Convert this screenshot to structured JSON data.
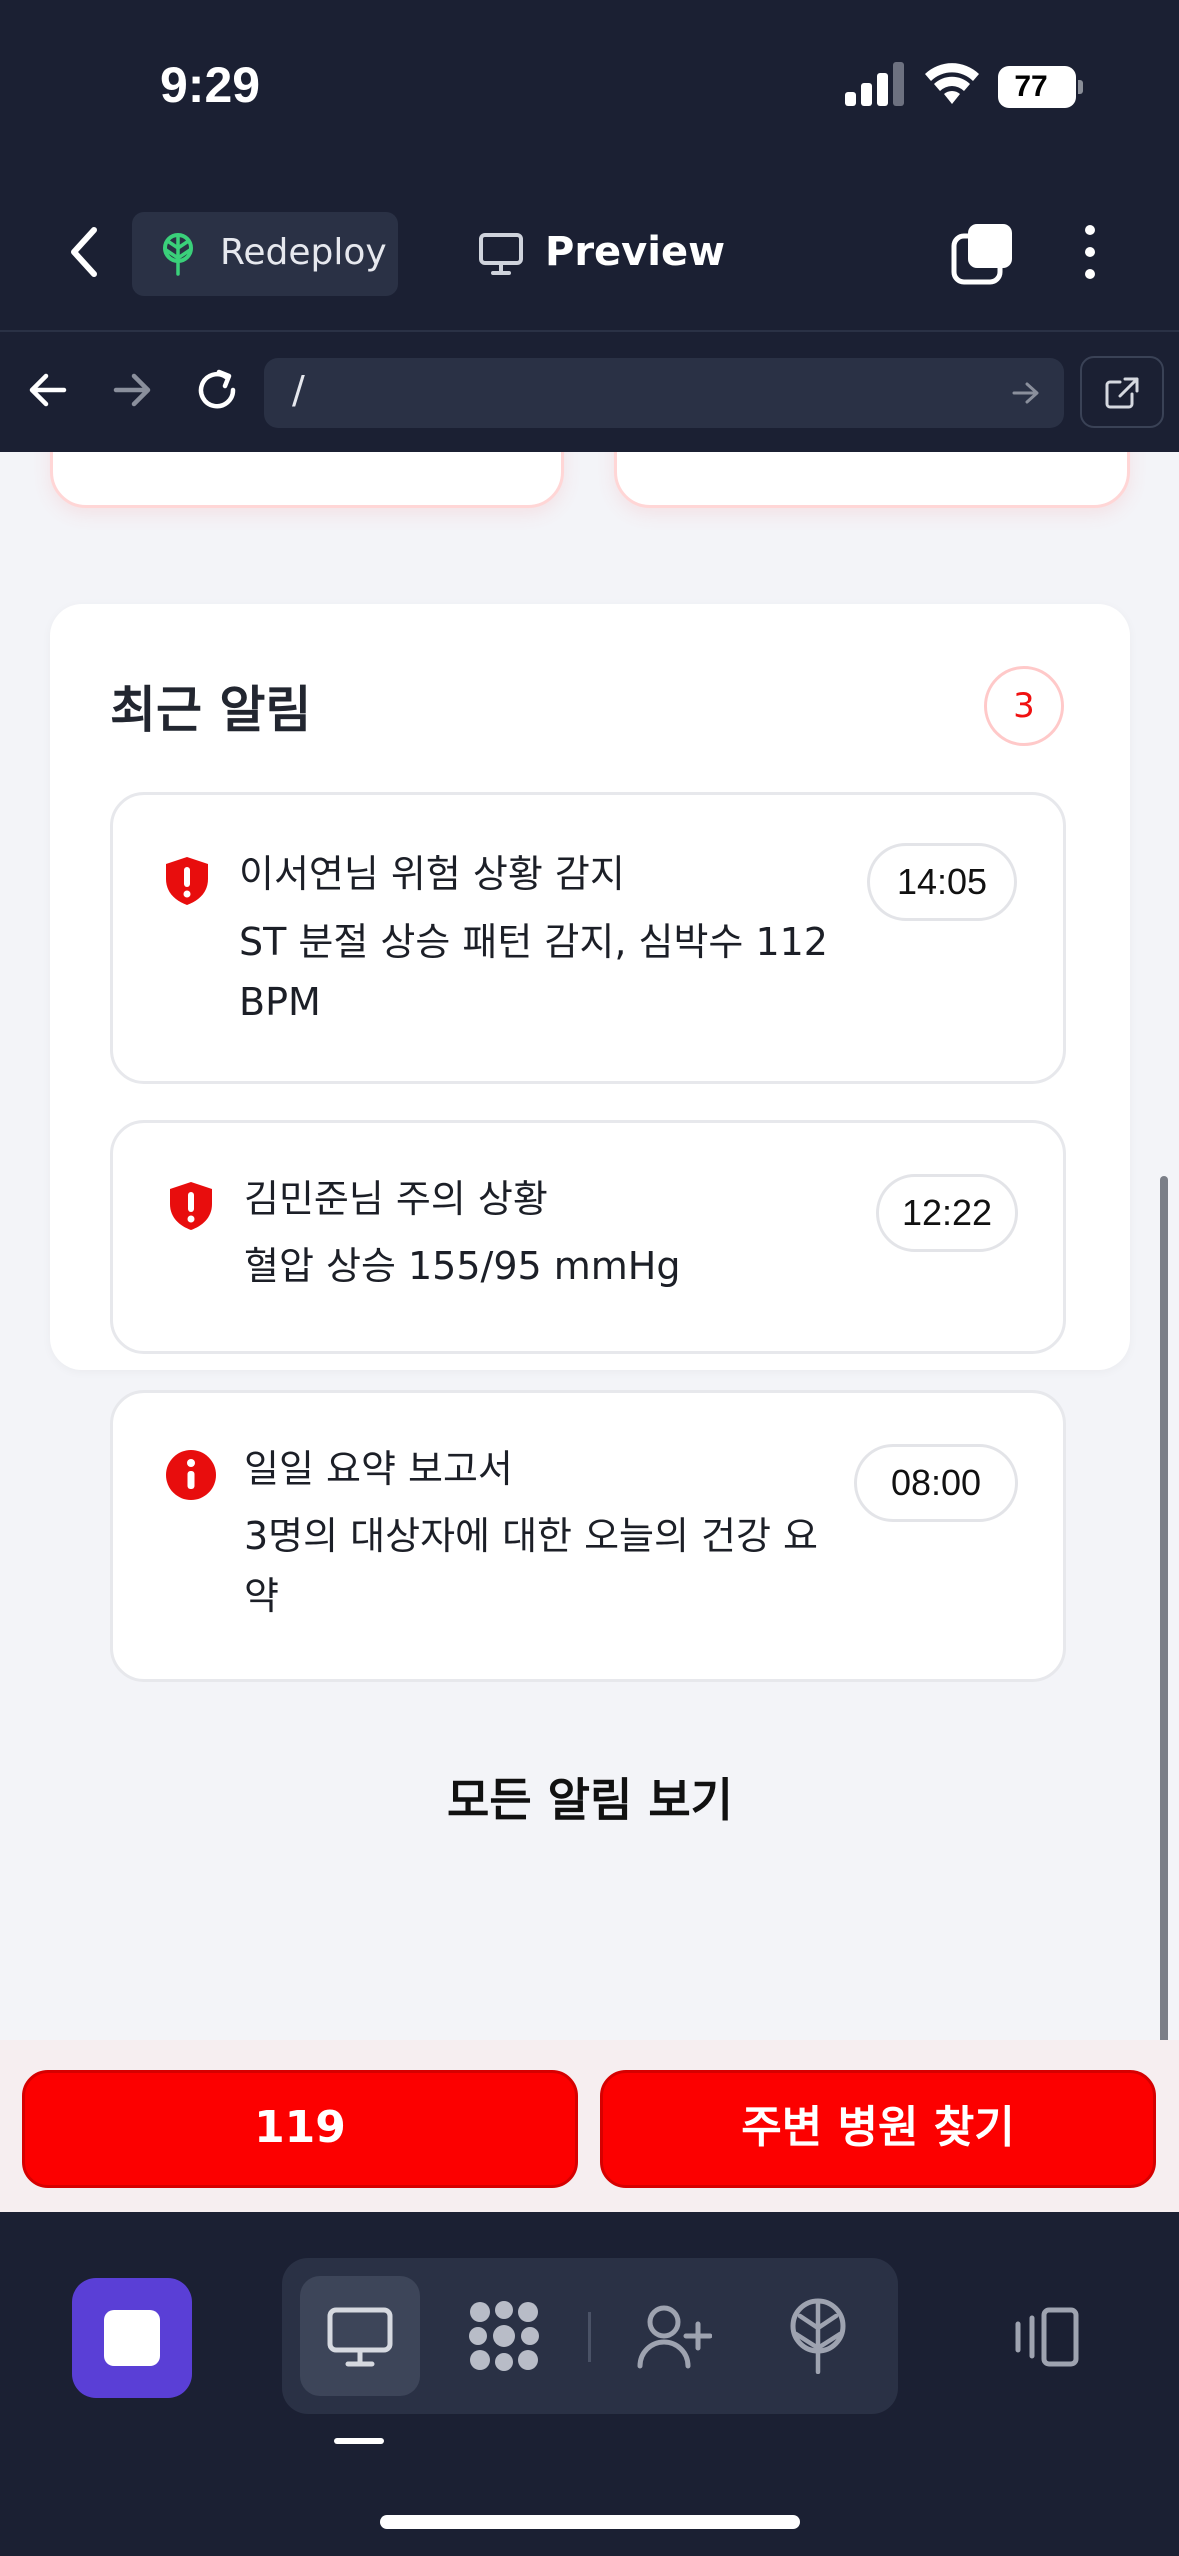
{
  "status_bar": {
    "time": "9:29",
    "battery": "77"
  },
  "header": {
    "redeploy_label": "Redeploy",
    "preview_label": "Preview"
  },
  "url_bar": {
    "url": "/"
  },
  "recent_alerts": {
    "title": "최근 알림",
    "count": "3",
    "items": [
      {
        "title": "이서연님 위험 상황 감지",
        "body": "ST 분절 상승 패턴 감지, 심박수 112 BPM",
        "time": "14:05",
        "icon": "shield-alert-icon"
      },
      {
        "title": "김민준님 주의 상황",
        "body": "혈압 상승 155/95 mmHg",
        "time": "12:22",
        "icon": "shield-alert-icon"
      },
      {
        "title": "일일 요약 보고서",
        "body": "3명의 대상자에 대한 오늘의 건강 요약",
        "time": "08:00",
        "icon": "info-icon"
      }
    ],
    "view_all_label": "모든 알림 보기"
  },
  "actions": {
    "emergency_label": "119",
    "hospital_label": "주변 병원 찾기"
  },
  "colors": {
    "accent_red": "#fc0000",
    "dark_bg": "#1b2033",
    "stop_purple": "#5a3fd6"
  }
}
